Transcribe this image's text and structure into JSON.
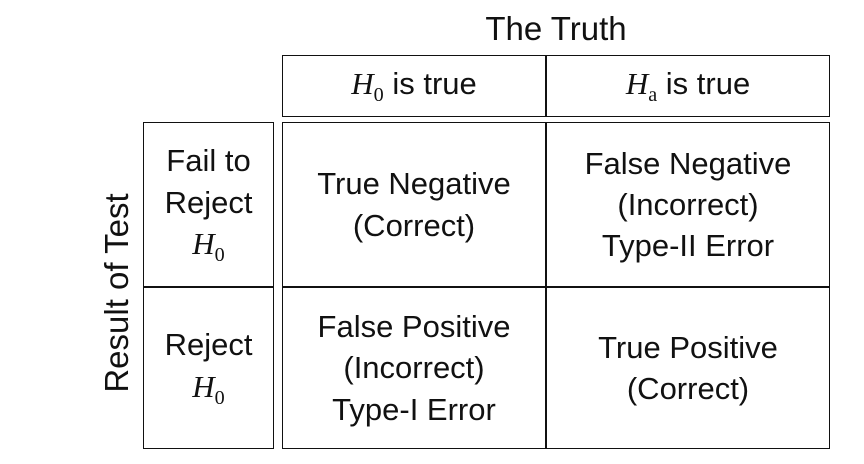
{
  "header": {
    "title": "The Truth",
    "columns": [
      {
        "prefix": "H",
        "sub": "0",
        "suffix": " is true"
      },
      {
        "prefix": "H",
        "sub": "a",
        "suffix": " is true"
      }
    ]
  },
  "side": {
    "title": "Result of Test",
    "rows": [
      {
        "line1": "Fail to",
        "line2": "Reject",
        "math_prefix": "H",
        "math_sub": "0"
      },
      {
        "line1": "Reject",
        "math_prefix": "H",
        "math_sub": "0"
      }
    ]
  },
  "grid": {
    "tn": {
      "line1": "True Negative",
      "line2": "(Correct)"
    },
    "fn": {
      "line1": "False Negative",
      "line2": "(Incorrect)",
      "line3": "Type-II Error"
    },
    "fp": {
      "line1": "False Positive",
      "line2": "(Incorrect)",
      "line3": "Type-I Error"
    },
    "tp": {
      "line1": "True Positive",
      "line2": "(Correct)"
    }
  }
}
